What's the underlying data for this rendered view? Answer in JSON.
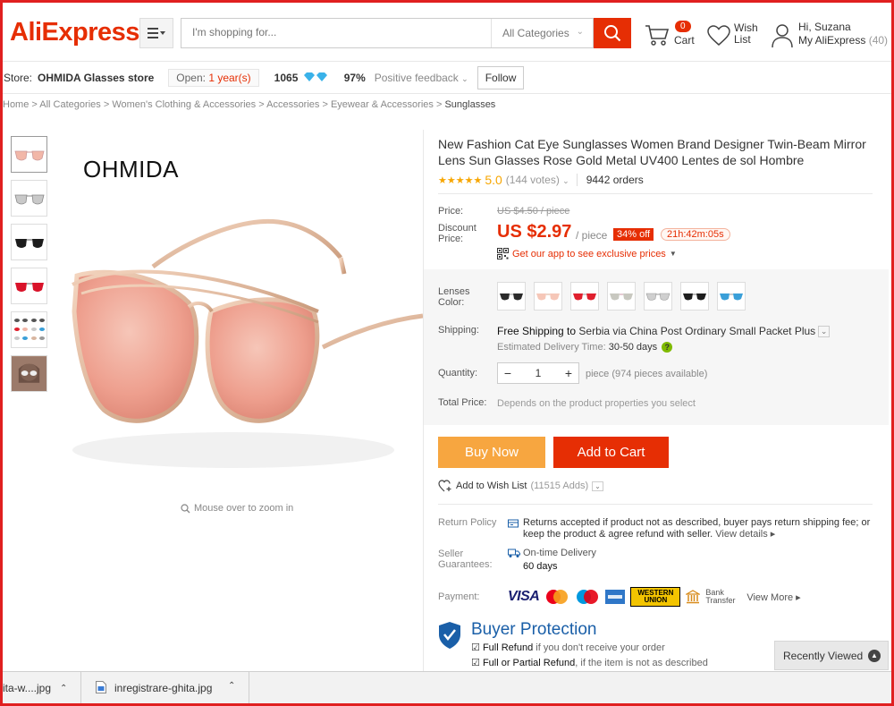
{
  "header": {
    "logo": "AliExpress",
    "logo_tm": "™",
    "search_placeholder": "I'm shopping for...",
    "category_select": "All Categories",
    "cart_count": "0",
    "cart_label": "Cart",
    "wish_label": "Wish List",
    "greeting": "Hi, Suzana",
    "account_label": "My AliExpress",
    "account_count": "(40)"
  },
  "store": {
    "label": "Store:",
    "name": "OHMIDA Glasses store",
    "open_prefix": "Open:",
    "open_value": "1 year(s)",
    "score": "1065",
    "feedback_pct": "97%",
    "feedback_label": "Positive feedback",
    "follow_label": "Follow"
  },
  "breadcrumb": {
    "items": [
      "Home",
      "All Categories",
      "Women's Clothing & Accessories",
      "Accessories",
      "Eyewear & Accessories"
    ],
    "current": "Sunglasses",
    "separator": ">"
  },
  "gallery": {
    "brand_text": "OHMIDA",
    "zoom_hint": "Mouse over to zoom in",
    "thumb_colors": [
      "#f2b7a8",
      "#c9c9c9",
      "#1c1c1c",
      "#d9132a",
      "#888888",
      "#b08d7a"
    ]
  },
  "product": {
    "title": "New Fashion Cat Eye Sunglasses Women Brand Designer Twin-Beam Mirror Lens Sun Glasses Rose Gold Metal UV400 Lentes de sol Hombre",
    "stars": "★★★★★",
    "rating": "5.0",
    "votes": "(144 votes)",
    "orders": "9442 orders",
    "price_label": "Price:",
    "price_original": "US $4.50 / piece",
    "discount_label": "Discount Price:",
    "price_discount": "US $2.97",
    "per_piece": "/ piece",
    "off_badge": "34% off",
    "timer": "21h:42m:05s",
    "app_promo": "Get our app to see exclusive prices"
  },
  "properties": {
    "lens_label": "Lenses Color:",
    "lens_colors": [
      "#2b2b2b",
      "#f6c7b8",
      "#e0202e",
      "#c8c8c0",
      "#cfcfcf",
      "#1e1e1e",
      "#3a9fd8"
    ],
    "shipping_label": "Shipping:",
    "shipping_free": "Free Shipping to",
    "shipping_rest": "Serbia via China Post Ordinary Small Packet Plus",
    "eta_label": "Estimated Delivery Time:",
    "eta_value": "30-50 days",
    "quantity_label": "Quantity:",
    "quantity_value": "1",
    "quantity_avail": "piece (974 pieces available)",
    "total_label": "Total Price:",
    "total_value": "Depends on the product properties you select"
  },
  "actions": {
    "buy_now": "Buy Now",
    "add_to_cart": "Add to Cart",
    "wishlist": "Add to Wish List",
    "wishlist_adds": "(11515 Adds)"
  },
  "policies": {
    "return_label": "Return Policy",
    "return_text": "Returns accepted if product not as described, buyer pays return shipping fee; or keep the product & agree refund with seller.",
    "view_details": "View details",
    "seller_label": "Seller Guarantees:",
    "seller_text1": "On-time Delivery",
    "seller_text2": "60 days",
    "payment_label": "Payment:",
    "payment_visa": "VISA",
    "payment_wu": "WESTERN UNION",
    "payment_bank": "Bank Transfer",
    "view_more": "View More"
  },
  "buyer_protection": {
    "title": "Buyer Protection",
    "item1_bold": "Full Refund",
    "item1_rest": "if you don't receive your order",
    "item2_bold": "Full or Partial Refund",
    "item2_rest": ", if the item is not as described"
  },
  "recently_viewed": "Recently Viewed",
  "downloads": [
    {
      "name": "ita-w....jpg"
    },
    {
      "name": "inregistrare-ghita.jpg"
    }
  ],
  "colors": {
    "accent": "#e62e04",
    "buy_now": "#f7a640",
    "rating": "#f7a600",
    "protection": "#1a5fa8"
  }
}
